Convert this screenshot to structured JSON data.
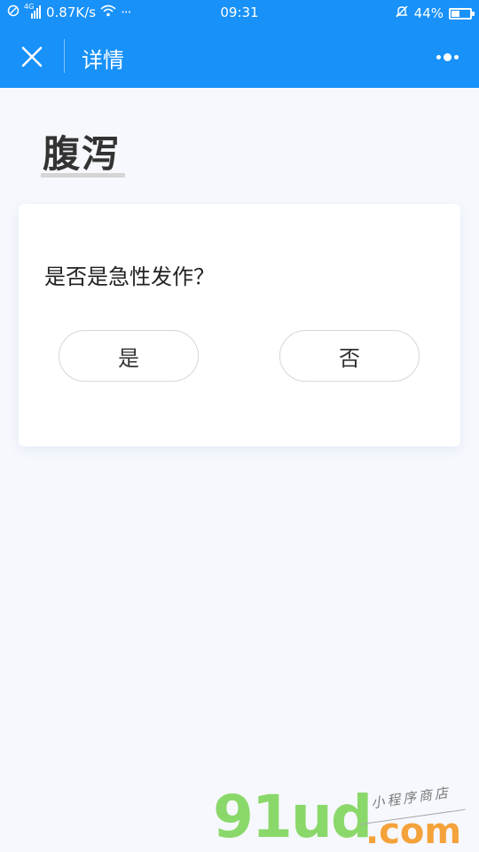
{
  "status_bar": {
    "network_type": "4G",
    "speed": "0.87K/s",
    "more": "···",
    "time": "09:31",
    "battery": "44%",
    "battery_level": 0.44
  },
  "navbar": {
    "title": "详情"
  },
  "page": {
    "heading": "腹泻"
  },
  "card": {
    "question": "是否是急性发作？",
    "options": [
      "是",
      "否"
    ]
  },
  "watermark": {
    "logo": "91ud",
    "logo_suffix": ".com",
    "tagline": "小程序商店"
  },
  "colors": {
    "primary": "#1891f9",
    "background": "#f6f8fd",
    "watermark_green": "#8bd86a",
    "watermark_orange": "#f4a23a"
  }
}
